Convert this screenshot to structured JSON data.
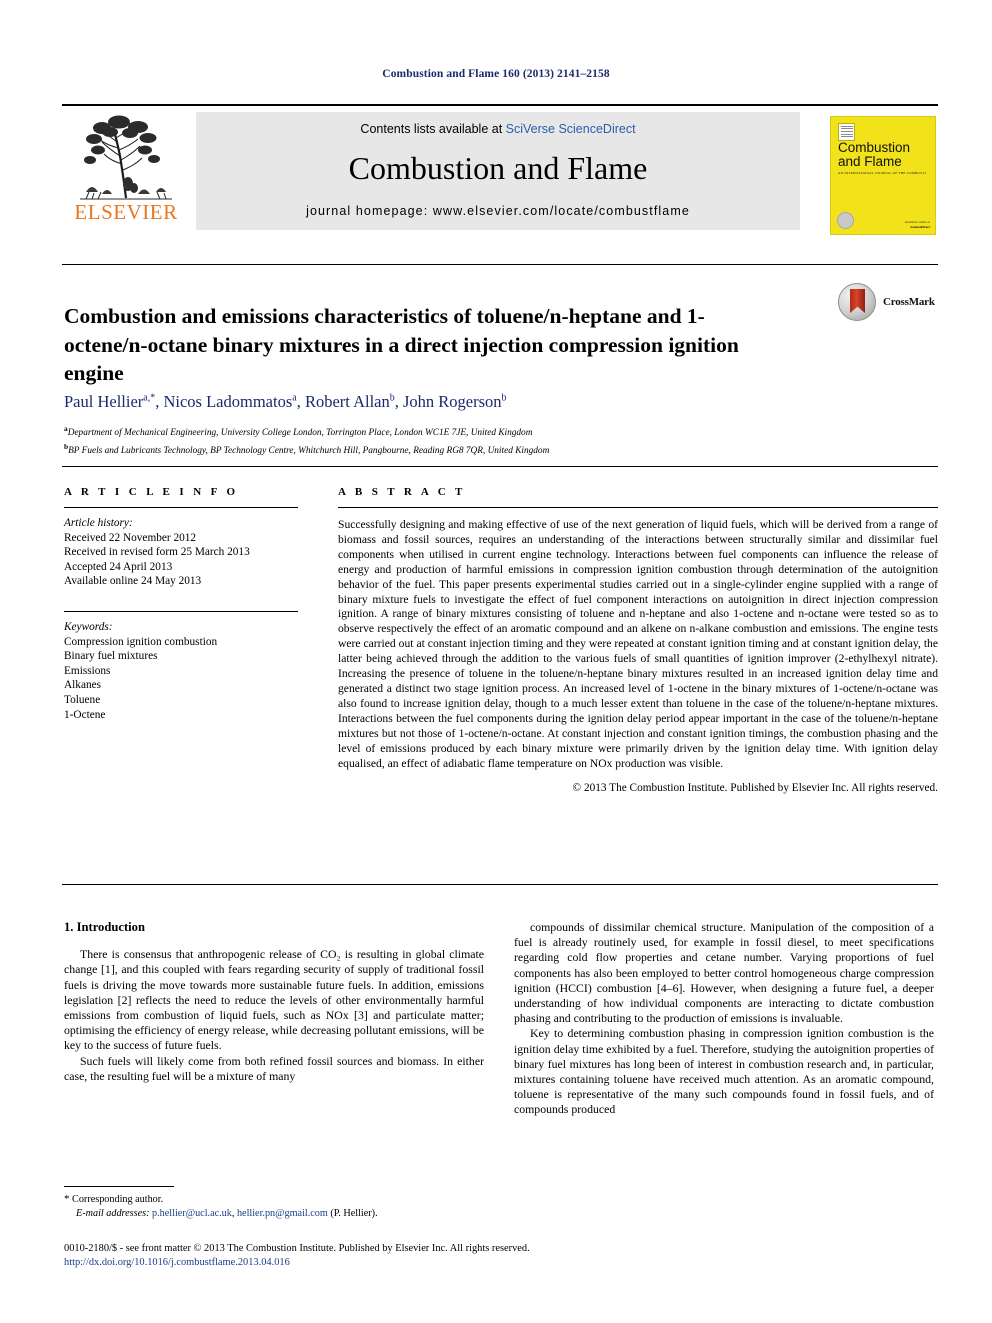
{
  "running_head": "Combustion and Flame 160 (2013) 2141–2158",
  "masthead": {
    "contents_prefix": "Contents lists available at ",
    "contents_link": "SciVerse ScienceDirect",
    "journal_title": "Combustion and Flame",
    "homepage": "journal homepage: www.elsevier.com/locate/combustflame",
    "publisher_name": "ELSEVIER",
    "publisher_logo_color": "#E87722",
    "cover": {
      "title_line1": "Combustion",
      "title_line2": "and Flame",
      "subtitle": "AN INTERNATIONAL JOURNAL OF THE COMBUSTION INSTITUTE",
      "footer_line1": "Available online at",
      "footer_line2": "ScienceDirect",
      "background_color": "#f2e21a"
    }
  },
  "article": {
    "title": "Combustion and emissions characteristics of toluene/n-heptane and 1-octene/n-octane binary mixtures in a direct injection compression ignition engine",
    "crossmark_label": "CrossMark",
    "authors": [
      {
        "name": "Paul Hellier",
        "marks": "a,*"
      },
      {
        "name": "Nicos Ladommatos",
        "marks": "a"
      },
      {
        "name": "Robert Allan",
        "marks": "b"
      },
      {
        "name": "John Rogerson",
        "marks": "b"
      }
    ],
    "affiliations": [
      {
        "mark": "a",
        "text": "Department of Mechanical Engineering, University College London, Torrington Place, London WC1E 7JE, United Kingdom"
      },
      {
        "mark": "b",
        "text": "BP Fuels and Lubricants Technology, BP Technology Centre, Whitchurch Hill, Pangbourne, Reading RG8 7QR, United Kingdom"
      }
    ]
  },
  "article_info": {
    "heading": "A R T I C L E   I N F O",
    "history_label": "Article history:",
    "history": [
      "Received 22 November 2012",
      "Received in revised form 25 March 2013",
      "Accepted 24 April 2013",
      "Available online 24 May 2013"
    ],
    "keywords_label": "Keywords:",
    "keywords": [
      "Compression ignition combustion",
      "Binary fuel mixtures",
      "Emissions",
      "Alkanes",
      "Toluene",
      "1-Octene"
    ]
  },
  "abstract": {
    "heading": "A B S T R A C T",
    "text": "Successfully designing and making effective of use of the next generation of liquid fuels, which will be derived from a range of biomass and fossil sources, requires an understanding of the interactions between structurally similar and dissimilar fuel components when utilised in current engine technology. Interactions between fuel components can influence the release of energy and production of harmful emissions in compression ignition combustion through determination of the autoignition behavior of the fuel. This paper presents experimental studies carried out in a single-cylinder engine supplied with a range of binary mixture fuels to investigate the effect of fuel component interactions on autoignition in direct injection compression ignition. A range of binary mixtures consisting of toluene and n-heptane and also 1-octene and n-octane were tested so as to observe respectively the effect of an aromatic compound and an alkene on n-alkane combustion and emissions. The engine tests were carried out at constant injection timing and they were repeated at constant ignition timing and at constant ignition delay, the latter being achieved through the addition to the various fuels of small quantities of ignition improver (2-ethylhexyl nitrate). Increasing the presence of toluene in the toluene/n-heptane binary mixtures resulted in an increased ignition delay time and generated a distinct two stage ignition process. An increased level of 1-octene in the binary mixtures of 1-octene/n-octane was also found to increase ignition delay, though to a much lesser extent than toluene in the case of the toluene/n-heptane mixtures. Interactions between the fuel components during the ignition delay period appear important in the case of the toluene/n-heptane mixtures but not those of 1-octene/n-octane. At constant injection and constant ignition timings, the combustion phasing and the level of emissions produced by each binary mixture were primarily driven by the ignition delay time. With ignition delay equalised, an effect of adiabatic flame temperature on NOx production was visible.",
    "copyright": "© 2013 The Combustion Institute. Published by Elsevier Inc. All rights reserved."
  },
  "body": {
    "section_heading": "1. Introduction",
    "left_paragraphs": [
      "There is consensus that anthropogenic release of CO₂ is resulting in global climate change [1], and this coupled with fears regarding security of supply of traditional fossil fuels is driving the move towards more sustainable future fuels. In addition, emissions legislation [2] reflects the need to reduce the levels of other environmentally harmful emissions from combustion of liquid fuels, such as NOx [3] and particulate matter; optimising the efficiency of energy release, while decreasing pollutant emissions, will be key to the success of future fuels.",
      "Such fuels will likely come from both refined fossil sources and biomass. In either case, the resulting fuel will be a mixture of many"
    ],
    "right_paragraphs": [
      "compounds of dissimilar chemical structure. Manipulation of the composition of a fuel is already routinely used, for example in fossil diesel, to meet specifications regarding cold flow properties and cetane number. Varying proportions of fuel components has also been employed to better control homogeneous charge compression ignition (HCCI) combustion [4–6]. However, when designing a future fuel, a deeper understanding of how individual components are interacting to dictate combustion phasing and contributing to the production of emissions is invaluable.",
      "Key to determining combustion phasing in compression ignition combustion is the ignition delay time exhibited by a fuel. Therefore, studying the autoignition properties of binary fuel mixtures has long been of interest in combustion research and, in particular, mixtures containing toluene have received much attention. As an aromatic compound, toluene is representative of the many such compounds found in fossil fuels, and of compounds produced"
    ]
  },
  "footnote": {
    "corresponding": "Corresponding author.",
    "email_label": "E-mail addresses:",
    "email1": "p.hellier@ucl.ac.uk",
    "email2": "hellier.pn@gmail.com",
    "email_suffix": "(P. Hellier)."
  },
  "page_footer": {
    "issn_line": "0010-2180/$ - see front matter © 2013 The Combustion Institute. Published by Elsevier Inc. All rights reserved.",
    "doi": "http://dx.doi.org/10.1016/j.combustflame.2013.04.016"
  }
}
